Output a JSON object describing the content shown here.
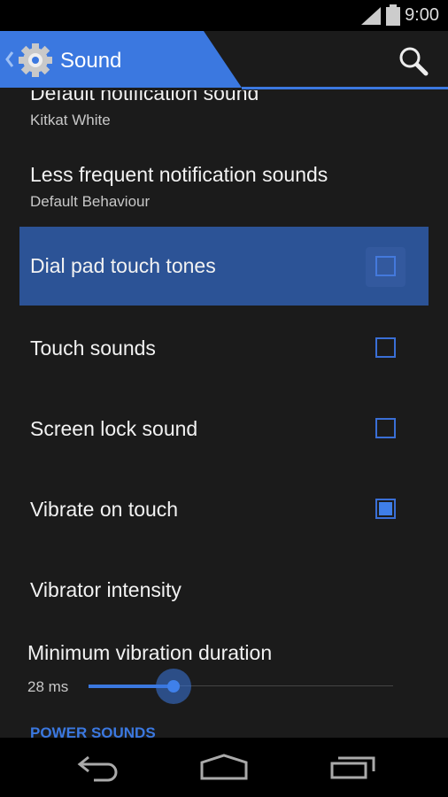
{
  "status_bar": {
    "time": "9:00",
    "icons": [
      "signal-icon",
      "battery-icon"
    ]
  },
  "action_bar": {
    "title": "Sound",
    "icon": "gear-icon",
    "back": "chevron-left-icon",
    "search": "search-icon",
    "accent": "#3b78e0"
  },
  "items": [
    {
      "title": "Default notification sound",
      "subtitle": "Kitkat White"
    },
    {
      "title": "Less frequent notification sounds",
      "subtitle": "Default Behaviour"
    },
    {
      "title": "Dial pad touch tones",
      "checked": false,
      "highlighted": true
    },
    {
      "title": "Touch sounds",
      "checked": false
    },
    {
      "title": "Screen lock sound",
      "checked": false
    },
    {
      "title": "Vibrate on touch",
      "checked": true
    },
    {
      "title": "Vibrator intensity"
    }
  ],
  "slider": {
    "title": "Minimum vibration duration",
    "value_label": "28 ms",
    "fraction": 0.28
  },
  "section_header": "POWER SOUNDS",
  "nav": {
    "back": "back-icon",
    "home": "home-icon",
    "recents": "recents-icon"
  }
}
